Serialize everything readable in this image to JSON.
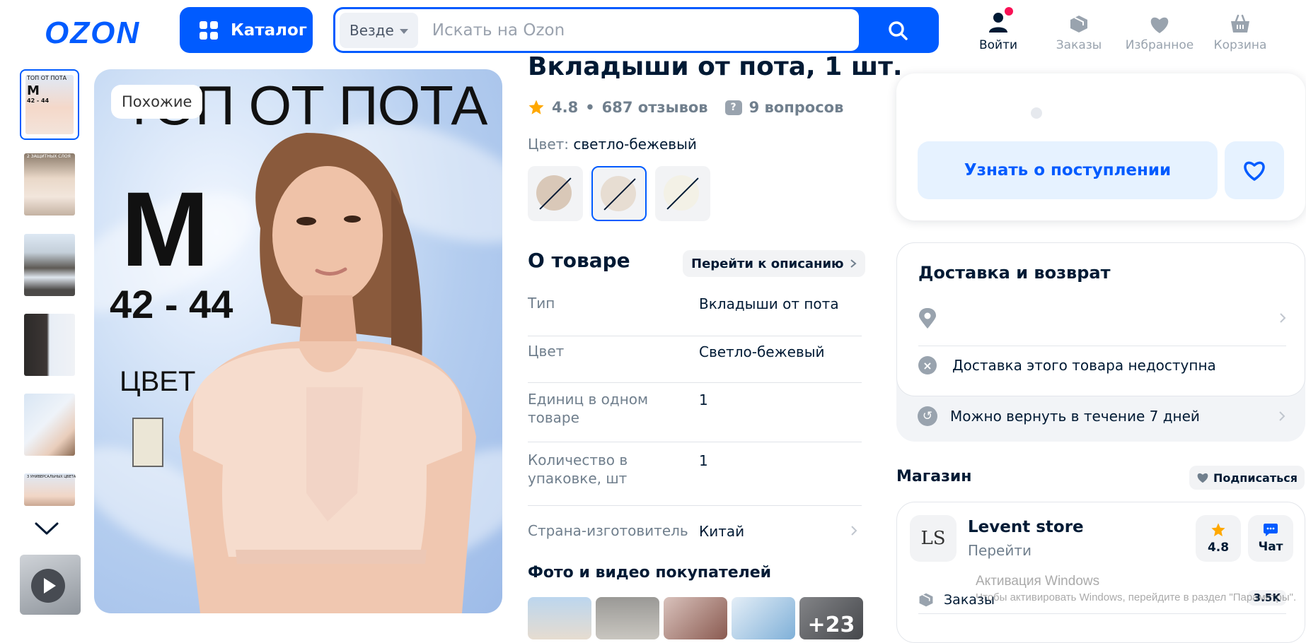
{
  "header": {
    "logo": "OZON",
    "catalog_label": "Каталог",
    "search": {
      "scope": "Везде",
      "placeholder": "Искать на Ozon"
    },
    "nav": [
      {
        "label": "Войти",
        "icon": "user-icon"
      },
      {
        "label": "Заказы",
        "icon": "box-icon"
      },
      {
        "label": "Избранное",
        "icon": "heart-icon"
      },
      {
        "label": "Корзина",
        "icon": "cart-icon"
      }
    ],
    "colors": {
      "brand": "#005bff",
      "notification": "#f91155"
    }
  },
  "gallery": {
    "similar_label": "Похожие",
    "image_text": {
      "title": "ТОП ОТ ПОТА",
      "size_letter": "M",
      "size_range": "42 - 44",
      "color_label": "ЦВЕТ"
    },
    "thumbnails": [
      {
        "active": true,
        "tiny_title": "ТОП ОТ ПОТА",
        "tiny_size": "M",
        "tiny_range": "42 - 44"
      },
      {
        "active": false,
        "tiny_title": "2 ЗАЩИТНЫХ СЛОЯ"
      },
      {
        "active": false
      },
      {
        "active": false
      },
      {
        "active": false
      },
      {
        "active": false,
        "tiny_title": "3 УНИВЕРСАЛЬНЫХ ЦВЕТА"
      }
    ]
  },
  "product": {
    "title": "Вкладыши от пота, 1 шт.",
    "rating": "4.8",
    "reviews": "687 отзывов",
    "questions": "9 вопросов",
    "color_label": "Цвет:",
    "color_value": "светло-бежевый",
    "swatches": [
      {
        "color": "#d9c8b8",
        "selected": false
      },
      {
        "color": "#e7ddd2",
        "selected": true
      },
      {
        "color": "#f3f1e6",
        "selected": false
      }
    ],
    "about_title": "О товаре",
    "goto_description": "Перейти к описанию",
    "properties": [
      {
        "key": "Тип",
        "value": "Вкладыши от пота"
      },
      {
        "key": "Цвет",
        "value": "Светло-бежевый"
      },
      {
        "key": "Единиц в одном товаре",
        "value": "1"
      },
      {
        "key": "Количество в упаковке, шт",
        "value": "1"
      },
      {
        "key": "Страна-изготовитель",
        "value": "Китай"
      }
    ],
    "photos_title": "Фото и видео покупателей",
    "photos_more": "+23"
  },
  "buybox": {
    "notify_label": "Узнать о поступлении"
  },
  "delivery": {
    "title": "Доставка и возврат",
    "unavailable": "Доставка этого товара недоступна",
    "return_text": "Можно вернуть в течение 7 дней"
  },
  "shop": {
    "section_title": "Магазин",
    "subscribe_label": "Подписаться",
    "logo_text": "LS",
    "name": "Levent store",
    "go_label": "Перейти",
    "rating": "4.8",
    "chat_label": "Чат",
    "orders_label": "Заказы",
    "orders_count": "3.5K"
  },
  "watermark": {
    "line1": "Активация Windows",
    "line2": "Чтобы активировать Windows, перейдите в раздел \"Параметры\"."
  }
}
